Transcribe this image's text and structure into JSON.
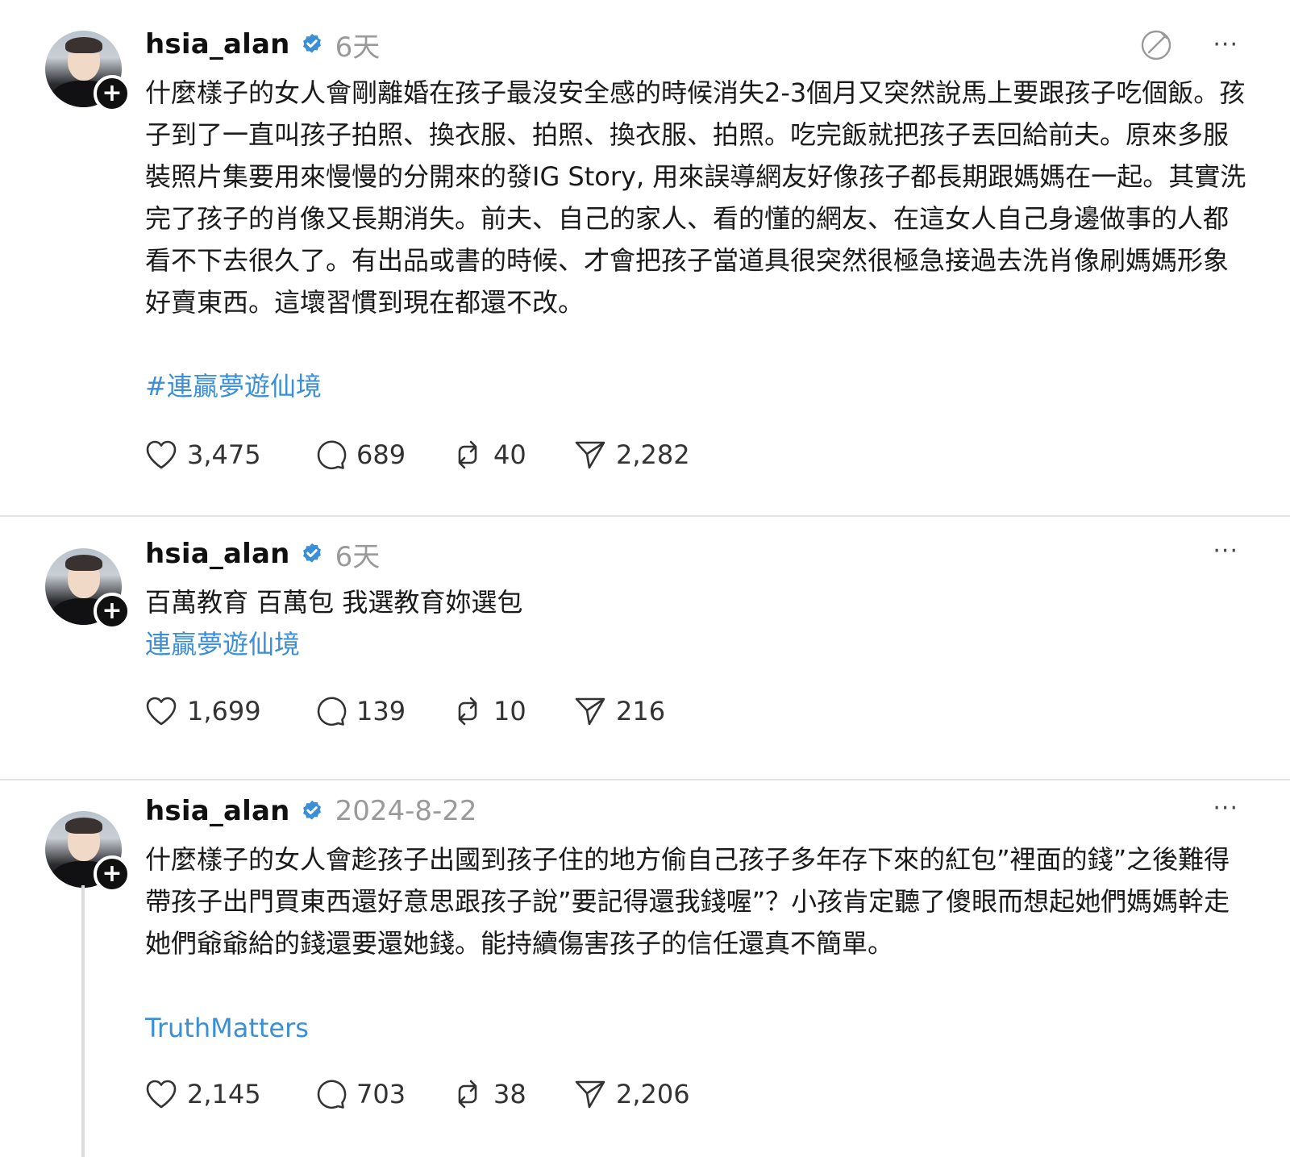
{
  "posts": [
    {
      "username": "hsia_alan",
      "time": "6天",
      "text": "什麼樣子的女人會剛離婚在孩子最沒安全感的時候消失2-3個月又突然說馬上要跟孩子吃個飯。孩子到了一直叫孩子拍照、換衣服、拍照、換衣服、拍照。吃完飯就把孩子丟回給前夫。原來多服裝照片集要用來慢慢的分開來的發IG Story, 用來誤導網友好像孩子都長期跟媽媽在一起。其實洗完了孩子的肖像又長期消失。前夫、自己的家人、看的懂的網友、在這女人自己身邊做事的人都看不下去很久了。有出品或書的時候、才會把孩子當道具很突然很極急接過去洗肖像刷媽媽形象好賣東西。這壞習慣到現在都還不改。",
      "tag": "#連贏夢遊仙境",
      "likes": "3,475",
      "replies": "689",
      "reposts": "40",
      "shares": "2,282"
    },
    {
      "username": "hsia_alan",
      "time": "6天",
      "text": "百萬教育 百萬包 我選教育妳選包",
      "tag": "連贏夢遊仙境",
      "likes": "1,699",
      "replies": "139",
      "reposts": "10",
      "shares": "216"
    },
    {
      "username": "hsia_alan",
      "time": "2024-8-22",
      "text": "什麼樣子的女人會趁孩子出國到孩子住的地方偷自己孩子多年存下來的紅包”裡面的錢”之後難得帶孩子出門買東西還好意思跟孩子說”要記得還我錢喔”？小孩肯定聽了傻眼而想起她們媽媽幹走她們爺爺給的錢還要還她錢。能持續傷害孩子的信任還真不簡單。",
      "tag": "TruthMatters",
      "likes": "2,145",
      "replies": "703",
      "reposts": "38",
      "shares": "2,206"
    }
  ],
  "icons": {
    "verified": "verified-badge-icon",
    "follow": "plus-icon",
    "quote": "quote-edit-icon",
    "more": "more-dots-icon",
    "like": "heart-icon",
    "reply": "comment-bubble-icon",
    "repost": "repost-icon",
    "share": "send-icon"
  },
  "ui": {
    "more_glyph": "···",
    "follow_glyph": "+"
  },
  "colors": {
    "link": "#3a8fd6",
    "verified": "#3a8fd6",
    "muted": "#9a9a9a"
  }
}
